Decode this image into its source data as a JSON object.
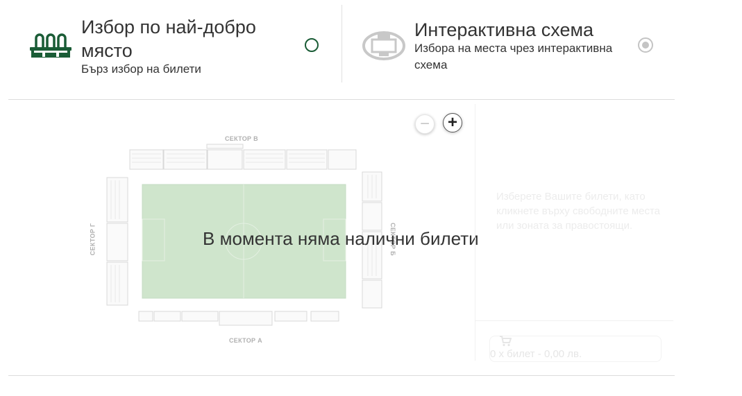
{
  "options": {
    "best_seat": {
      "title": "Избор по най-добро място",
      "subtitle": "Бърз избор на билети",
      "icon": "seats-icon",
      "selected": false,
      "accent": "#1a5c36"
    },
    "interactive_map": {
      "title": "Интерактивна схема",
      "subtitle": "Избора на места чрез интерактивна схема",
      "icon": "stadium-icon",
      "selected": true,
      "accent": "#c4c4c4"
    }
  },
  "map": {
    "zoom_out": "−",
    "zoom_in": "+",
    "sectors": {
      "north": "СЕКТОР В",
      "south": "СЕКТОР А",
      "west": "СЕКТОР Г",
      "east": "СЕКТОР Б"
    },
    "no_tickets": "В момента няма налични билети",
    "pitch_color": "#cfe5cc"
  },
  "sidebar": {
    "hint": "Изберете Вашите билети, като кликнете върху свободните места или зоната за правостоящи.",
    "cart_summary": "0 x билет - 0,00 лв.",
    "cart_icon": "cart-icon"
  }
}
